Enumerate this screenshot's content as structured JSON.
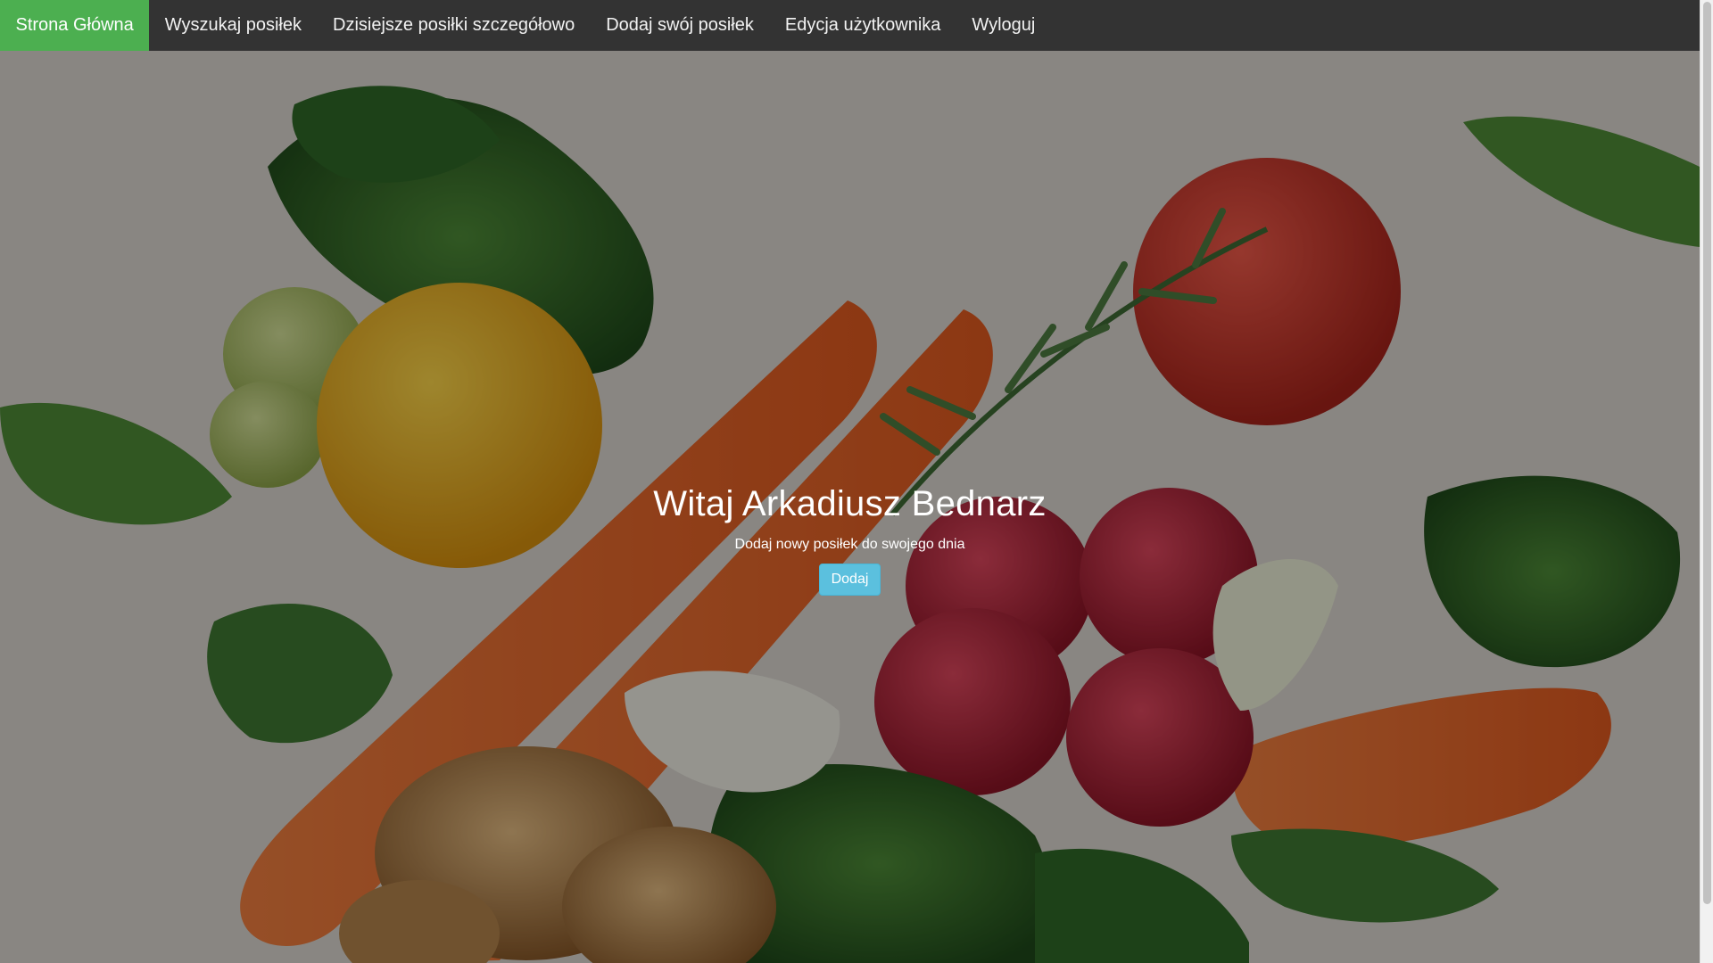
{
  "navbar": {
    "items": [
      {
        "label": "Strona Główna",
        "active": true
      },
      {
        "label": "Wyszukaj posiłek",
        "active": false
      },
      {
        "label": "Dzisiejsze posiłki szczegółowo",
        "active": false
      },
      {
        "label": "Dodaj swój posiłek",
        "active": false
      },
      {
        "label": "Edycja użytkownika",
        "active": false
      },
      {
        "label": "Wyloguj",
        "active": false
      }
    ]
  },
  "hero": {
    "title": "Witaj Arkadiusz Bednarz",
    "subtitle": "Dodaj nowy posiłek do swojego dnia",
    "button_label": "Dodaj",
    "background_image": "vegetables-photo"
  },
  "colors": {
    "navbar_bg": "#333333",
    "active_item": "#4caf50",
    "button": "#5bc0de"
  }
}
